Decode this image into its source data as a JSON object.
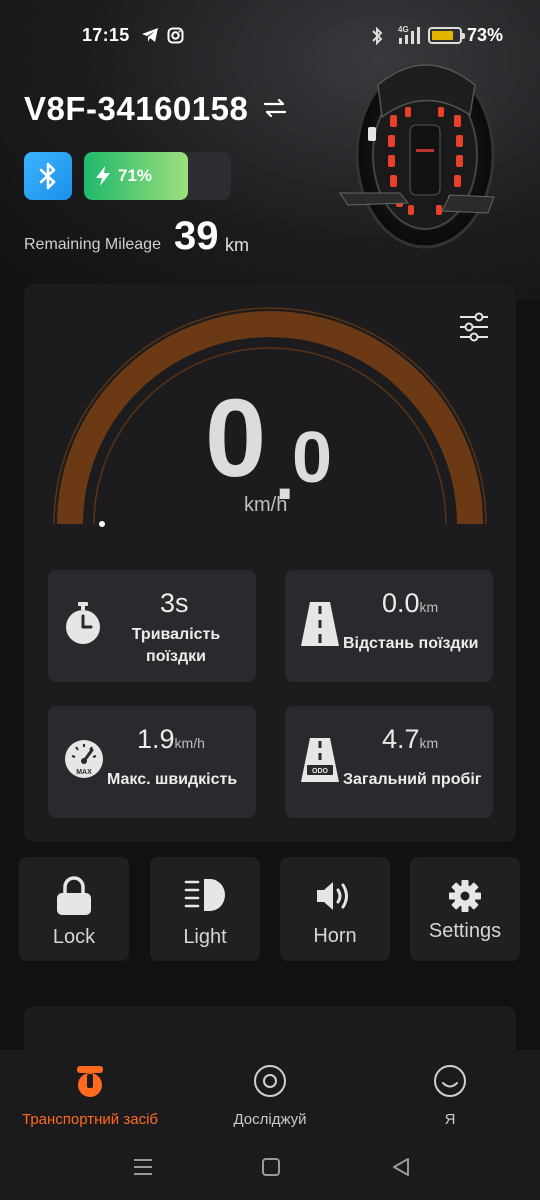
{
  "status_bar": {
    "time": "17:15",
    "battery_percent": "73%",
    "network": "4G"
  },
  "header": {
    "device_name": "V8F-34160158",
    "battery_percent_label": "71%",
    "battery_level": 0.71,
    "remaining_mileage_label": "Remaining Mileage",
    "remaining_mileage_value": "39",
    "remaining_mileage_unit": "km"
  },
  "speedometer": {
    "speed_integer": "0",
    "speed_dot": ".",
    "speed_decimal": "0",
    "unit": "km/h",
    "arc_color": "#6b3a15",
    "indicator_level": 0
  },
  "stats": {
    "trip_duration": {
      "value": "3s",
      "unit": "",
      "label_line1": "Тривалість",
      "label_line2": "поїздки"
    },
    "trip_distance": {
      "value": "0.0",
      "unit": "km",
      "label": "Відстань поїздки"
    },
    "max_speed": {
      "value": "1.9",
      "unit": "km/h",
      "label": "Макс. швидкість",
      "badge": "MAX"
    },
    "total_mileage": {
      "value": "4.7",
      "unit": "km",
      "label": "Загальний пробіг",
      "badge": "ODO"
    }
  },
  "quick_actions": [
    {
      "label": "Lock",
      "icon": "lock-icon"
    },
    {
      "label": "Light",
      "icon": "headlight-icon"
    },
    {
      "label": "Horn",
      "icon": "horn-icon"
    },
    {
      "label": "Settings",
      "icon": "gear-icon"
    }
  ],
  "bottom_nav": [
    {
      "label": "Транспортний засіб",
      "icon": "vehicle-icon",
      "active": true
    },
    {
      "label": "Досліджуй",
      "icon": "explore-icon",
      "active": false
    },
    {
      "label": "Я",
      "icon": "profile-icon",
      "active": false
    }
  ],
  "colors": {
    "accent": "#ff6a1f",
    "bluetooth": "#2ea6f5",
    "battery_start": "#1fb86c",
    "battery_end": "#9de07c",
    "background": "#111111",
    "card": "#1c1c1f"
  }
}
